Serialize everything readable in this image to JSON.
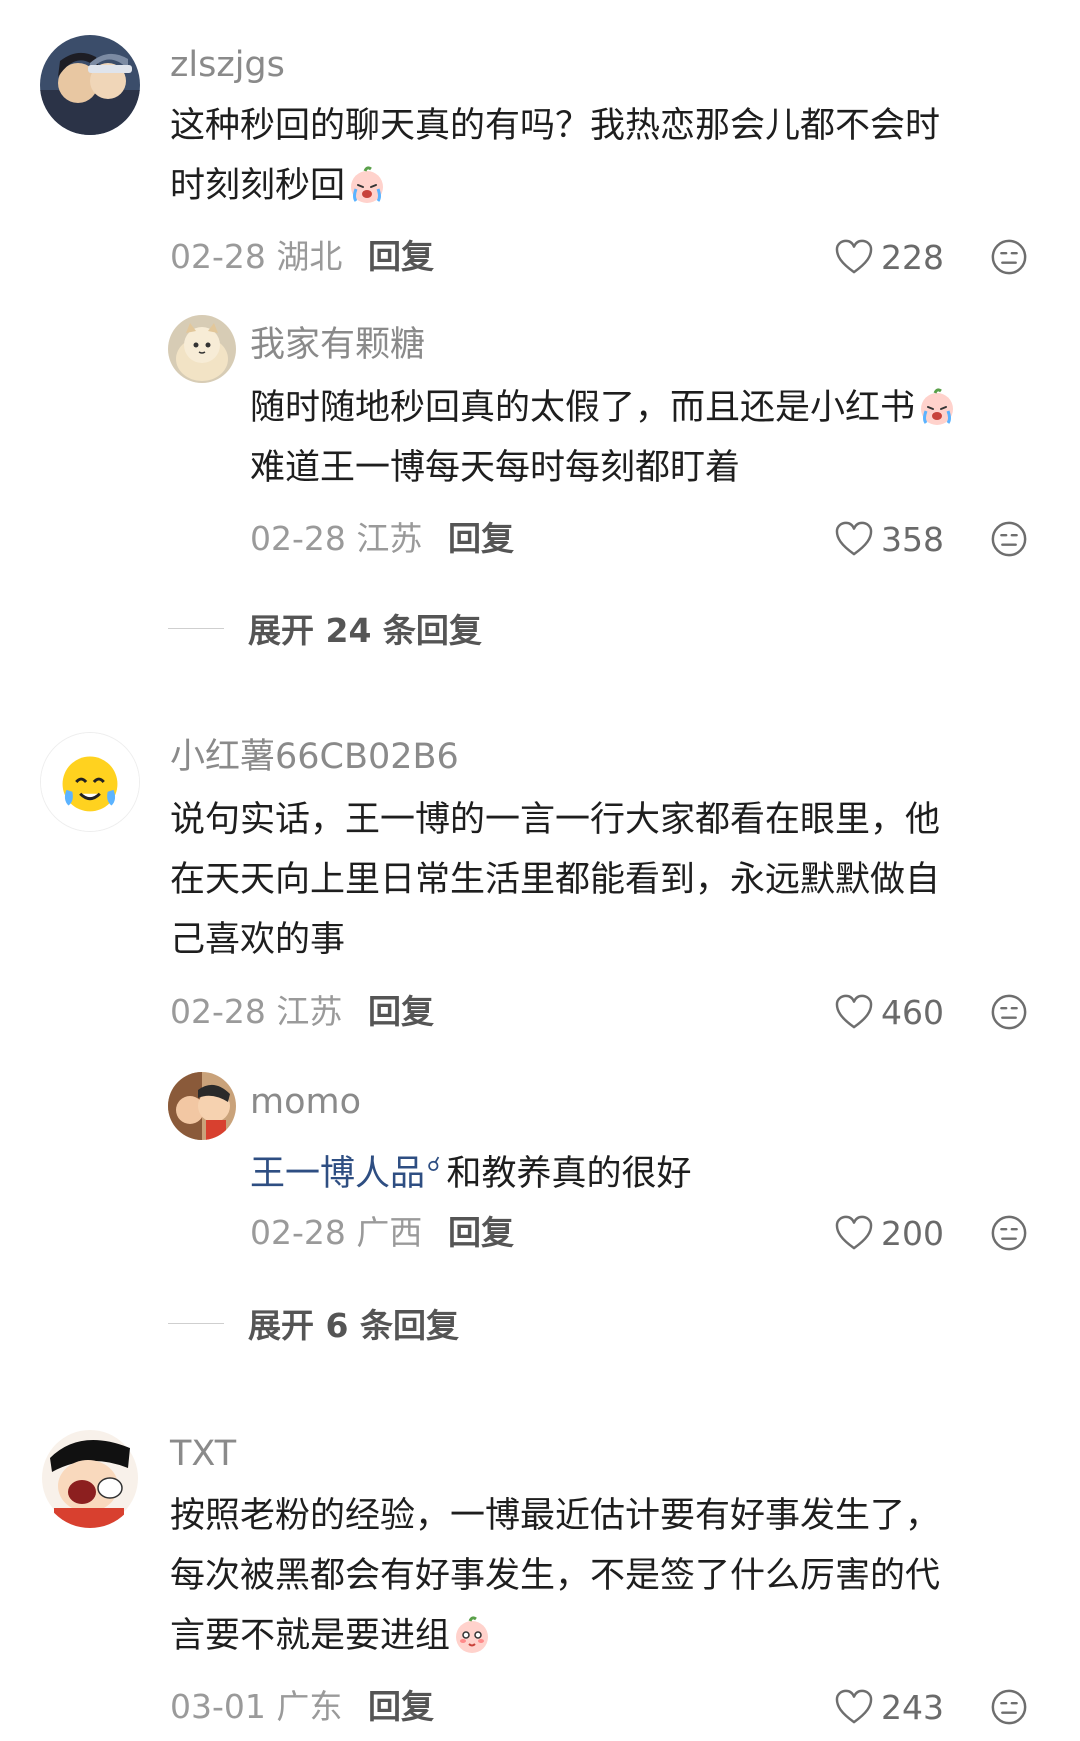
{
  "comments": [
    {
      "username": "zlszjgs",
      "text_line1": "这种秒回的聊天真的有吗？我热恋那会儿都不会时",
      "text_line2": "时刻刻秒回",
      "emoji": "crying-face-emoji",
      "date_location": "02-28 湖北",
      "reply_label": "回复",
      "likes": "228",
      "reply": {
        "username": "我家有颗糖",
        "text_line1": "随时随地秒回真的太假了，而且还是小红书",
        "emoji": "crying-face-emoji",
        "text_line2": "难道王一博每天每时每刻都盯着",
        "date_location": "02-28 江苏",
        "reply_label": "回复",
        "likes": "358"
      },
      "expand_label": "展开 24 条回复"
    },
    {
      "username": "小红薯66CB02B6",
      "text_line1": "说句实话，王一博的一言一行大家都看在眼里，他",
      "text_line2": "在天天向上里日常生活里都能看到，永远默默做自",
      "text_line3": "己喜欢的事",
      "date_location": "02-28 江苏",
      "reply_label": "回复",
      "likes": "460",
      "reply": {
        "username": "momo",
        "link_text": "王一博人品",
        "text_rest": "和教养真的很好",
        "date_location": "02-28 广西",
        "reply_label": "回复",
        "likes": "200"
      },
      "expand_label": "展开 6 条回复"
    },
    {
      "username": "TXT",
      "text_line1": "按照老粉的经验，一博最近估计要有好事发生了，",
      "text_line2": "每次被黑都会有好事发生，不是签了什么厉害的代",
      "text_line3": "言要不就是要进组",
      "emoji": "blushing-face-emoji",
      "date_location": "03-01 广东",
      "reply_label": "回复",
      "likes": "243"
    }
  ],
  "icons": {
    "like": "heart-icon",
    "dislike": "meh-face-icon",
    "search": "search-icon"
  },
  "colors": {
    "username": "#8a8a8a",
    "text": "#1e1e1e",
    "meta": "#9a9a9a",
    "link": "#2e4e82"
  }
}
